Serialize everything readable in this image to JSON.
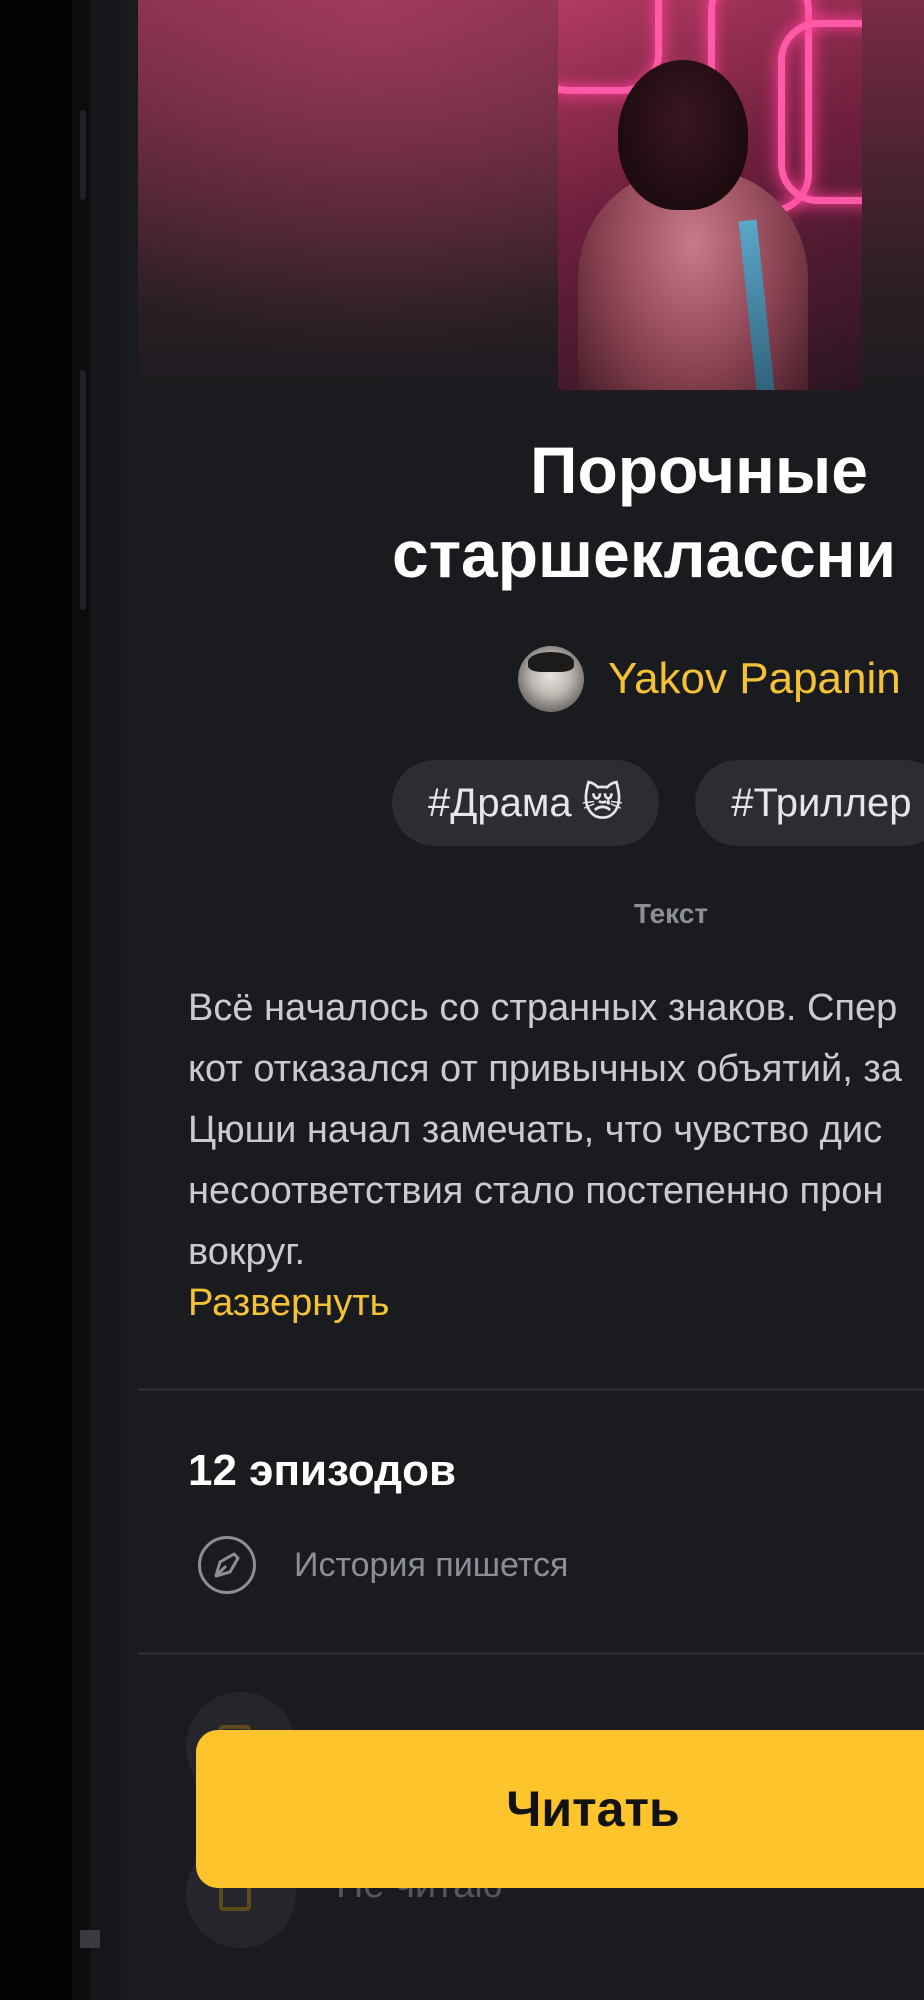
{
  "story": {
    "title_line1": "Порочные",
    "title_line2": "старшеклассни",
    "author": {
      "name": "Yakov Papanin"
    },
    "tags": [
      {
        "label": "#Драма",
        "emoji": "😿"
      },
      {
        "label": "#Триллер",
        "emoji": ""
      }
    ],
    "type_label": "Текст",
    "description_lines": [
      "Всё началось со странных знаков. Спер",
      "кот отказался от привычных объятий, за",
      "Цюши начал замечать, что чувство дис",
      "несоответствия стало постепенно прон",
      "вокруг."
    ],
    "expand_label": "Развернуть"
  },
  "episodes": {
    "count_label": "12 эпизодов",
    "status_label": "История пишется"
  },
  "reading_list": {
    "item2_label": "Не читаю"
  },
  "actions": {
    "read_label": "Читать"
  },
  "colors": {
    "background": "#1a1b1f",
    "accent": "#fdc42c",
    "author": "#f4c233",
    "muted": "#8b8e96"
  },
  "icons": {
    "writing": "pen-circle-icon",
    "not-reading": "bookmark-icon"
  }
}
